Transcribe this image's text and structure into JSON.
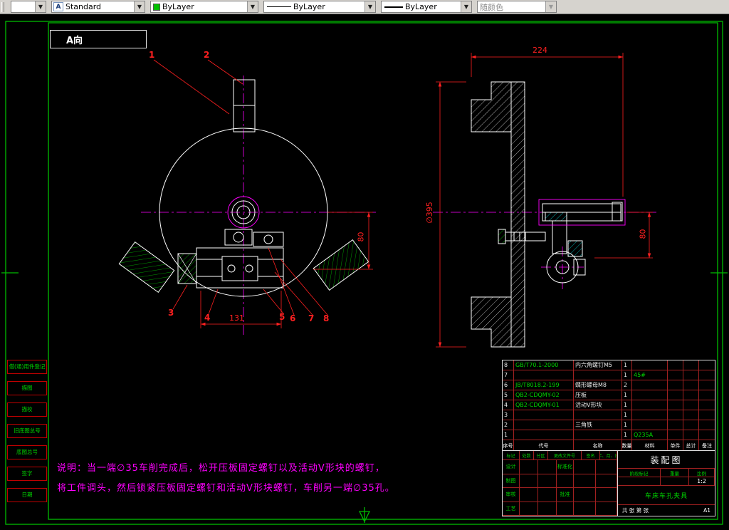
{
  "toolbar": {
    "layer_value": "",
    "text_style_value": "Standard",
    "color_value": "ByLayer",
    "linetype_value": "ByLayer",
    "lineweight_value": "ByLayer",
    "plot_style_value": "随颜色"
  },
  "sheet": {
    "view_label": "A向",
    "sidebar_labels": [
      "借(通)用件登记",
      "描图",
      "描校",
      "旧底图总号",
      "底图总号",
      "签字",
      "日期"
    ],
    "balloons": [
      "1",
      "2",
      "3",
      "4",
      "5",
      "6",
      "7",
      "8"
    ],
    "dims": {
      "front_width": "131",
      "front_height": "80",
      "section_width": "224",
      "section_dia": "∅395",
      "section_height": "80"
    },
    "notes": [
      "说明：当一端∅35车削完成后，松开压板固定螺钉以及活动V形块的螺钉，",
      "将工件调头，然后锁紧压板固定螺钉和活动V形块螺钉，车削另一端∅35孔。"
    ]
  },
  "parts_list": {
    "headers": [
      "序号",
      "代号",
      "名称",
      "数量",
      "材料",
      "单件",
      "总计",
      "备注"
    ],
    "rows": [
      {
        "no": "8",
        "code": "GB/T70.1-2000",
        "name": "内六角螺钉M5",
        "qty": "1",
        "material": "",
        "unit": "",
        "total": "",
        "remark": ""
      },
      {
        "no": "7",
        "code": "",
        "name": "",
        "qty": "1",
        "material": "45#",
        "unit": "",
        "total": "",
        "remark": ""
      },
      {
        "no": "6",
        "code": "JB/T8018.2-199",
        "name": "蝶形螺母M8",
        "qty": "2",
        "material": "",
        "unit": "",
        "total": "",
        "remark": ""
      },
      {
        "no": "5",
        "code": "QB2-CDQMY-02",
        "name": "压板",
        "qty": "1",
        "material": "",
        "unit": "",
        "total": "",
        "remark": ""
      },
      {
        "no": "4",
        "code": "QB2-CDQMY-01",
        "name": "活动V形块",
        "qty": "1",
        "material": "",
        "unit": "",
        "total": "",
        "remark": ""
      },
      {
        "no": "3",
        "code": "",
        "name": "",
        "qty": "1",
        "material": "",
        "unit": "",
        "total": "",
        "remark": ""
      },
      {
        "no": "2",
        "code": "",
        "name": "三角铁",
        "qty": "1",
        "material": "",
        "unit": "",
        "total": "",
        "remark": ""
      },
      {
        "no": "1",
        "code": "",
        "name": "",
        "qty": "1",
        "material": "Q235A",
        "unit": "",
        "total": "",
        "remark": ""
      }
    ]
  },
  "title_block": {
    "doc_type": "装配图",
    "part_name": "车床车孔夹具",
    "stage_label": "阶段标记",
    "weight_label": "重量",
    "scale_label": "比例",
    "scale": "1:2",
    "sheet_info": "共 张 第 张",
    "size": "A1",
    "revision_headers": [
      "标记",
      "处数",
      "分区",
      "更改文件号",
      "签名",
      "年、月、日"
    ],
    "staff_labels": {
      "design": "设计",
      "draw": "制图",
      "check": "审核",
      "process": "工艺",
      "standard": "标准化",
      "approve": "批准"
    }
  }
}
